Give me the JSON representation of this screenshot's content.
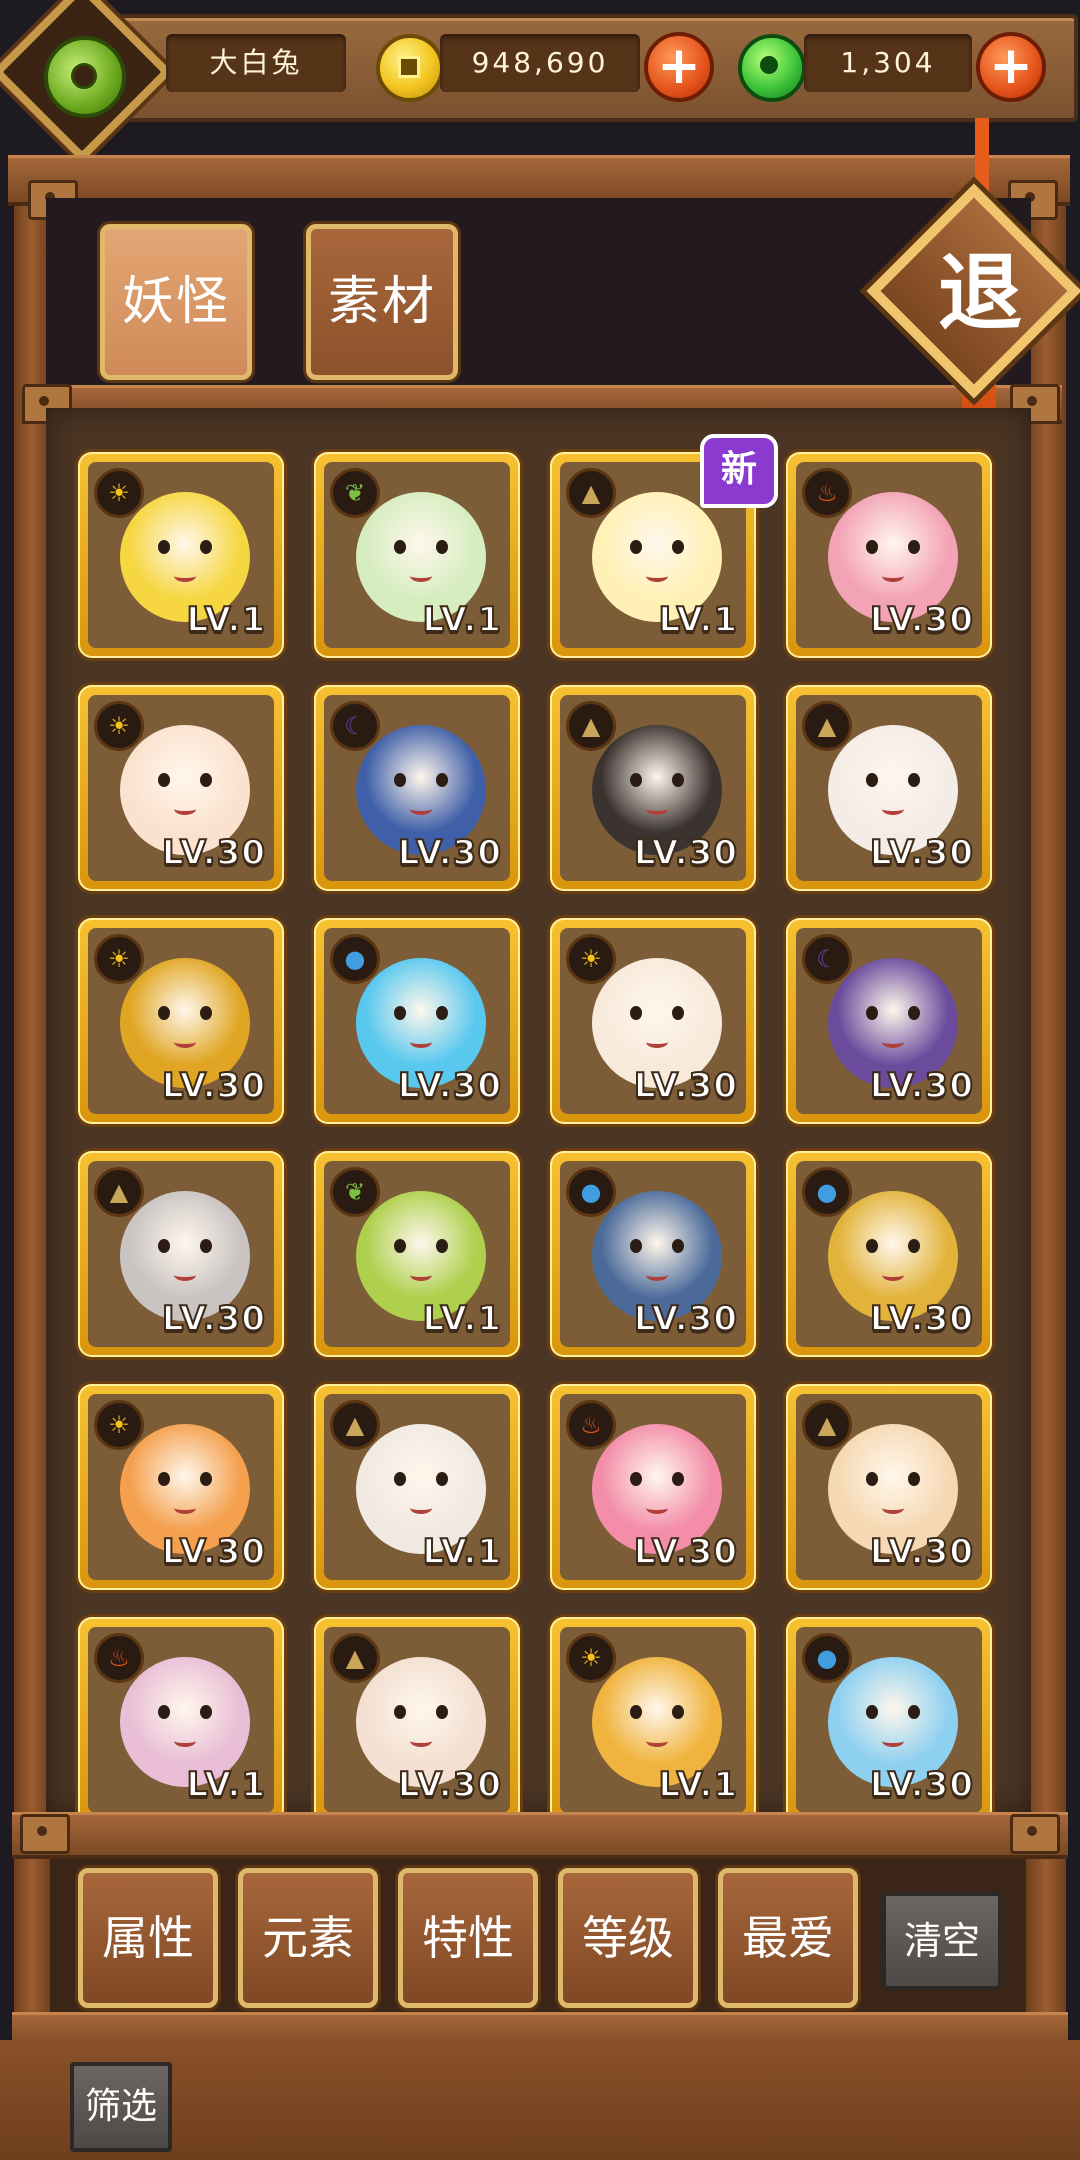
{
  "player": {
    "name": "大白兔"
  },
  "currency": {
    "coins": "948,690",
    "gems": "1,304",
    "coin_icon": "gold-coin-icon",
    "gem_icon": "jade-gem-icon",
    "add_symbol": "+"
  },
  "tabs": [
    {
      "label": "妖怪",
      "active": true
    },
    {
      "label": "素材",
      "active": false
    }
  ],
  "exit_label": "退",
  "monsters": [
    {
      "element": "light",
      "level": "LV.1",
      "color": "#f6d742",
      "new": false
    },
    {
      "element": "leaf",
      "level": "LV.1",
      "color": "#d6edc0",
      "new": false
    },
    {
      "element": "earth",
      "level": "LV.1",
      "color": "#fff1b5",
      "new": true,
      "badge": "新"
    },
    {
      "element": "fire",
      "level": "LV.30",
      "color": "#f3a3b6",
      "new": false
    },
    {
      "element": "light",
      "level": "LV.30",
      "color": "#fbe2cf",
      "new": false
    },
    {
      "element": "dark",
      "level": "LV.30",
      "color": "#3f5fa8",
      "new": false
    },
    {
      "element": "earth",
      "level": "LV.30",
      "color": "#3a3330",
      "new": false
    },
    {
      "element": "earth",
      "level": "LV.30",
      "color": "#f4ece6",
      "new": false
    },
    {
      "element": "light",
      "level": "LV.30",
      "color": "#e0a623",
      "new": false
    },
    {
      "element": "water",
      "level": "LV.30",
      "color": "#58c8ef",
      "new": false
    },
    {
      "element": "light",
      "level": "LV.30",
      "color": "#f7eadb",
      "new": false
    },
    {
      "element": "dark",
      "level": "LV.30",
      "color": "#6a4b9c",
      "new": false
    },
    {
      "element": "earth",
      "level": "LV.30",
      "color": "#c9c3c2",
      "new": false
    },
    {
      "element": "leaf",
      "level": "LV.1",
      "color": "#aed04d",
      "new": false
    },
    {
      "element": "water",
      "level": "LV.30",
      "color": "#4b6a9a",
      "new": false
    },
    {
      "element": "water",
      "level": "LV.30",
      "color": "#e2b33b",
      "new": false
    },
    {
      "element": "light",
      "level": "LV.30",
      "color": "#f4a04e",
      "new": false
    },
    {
      "element": "earth",
      "level": "LV.1",
      "color": "#f1eae2",
      "new": false
    },
    {
      "element": "fire",
      "level": "LV.30",
      "color": "#f38da9",
      "new": false
    },
    {
      "element": "earth",
      "level": "LV.30",
      "color": "#f6d9b4",
      "new": false
    },
    {
      "element": "fire",
      "level": "LV.1",
      "color": "#e9bed6",
      "new": false
    },
    {
      "element": "earth",
      "level": "LV.30",
      "color": "#f3e0d2",
      "new": false
    },
    {
      "element": "light",
      "level": "LV.1",
      "color": "#f0b33d",
      "new": false
    },
    {
      "element": "water",
      "level": "LV.30",
      "color": "#8ed0f0",
      "new": false
    }
  ],
  "element_styles": {
    "light": {
      "icon": "sun-icon",
      "glyph": "☀",
      "color": "#f8c21a"
    },
    "leaf": {
      "icon": "leaf-icon",
      "glyph": "❦",
      "color": "#7cc043"
    },
    "earth": {
      "icon": "mountain-icon",
      "glyph": "▲",
      "color": "#c9a65a"
    },
    "fire": {
      "icon": "flame-icon",
      "glyph": "♨",
      "color": "#e8571a"
    },
    "dark": {
      "icon": "moon-icon",
      "glyph": "☾",
      "color": "#6b3fa8"
    },
    "water": {
      "icon": "droplet-icon",
      "glyph": "●",
      "color": "#3f9de0"
    }
  },
  "filters": [
    "属性",
    "元素",
    "特性",
    "等级",
    "最爱"
  ],
  "clear_label": "清空",
  "filter_label": "筛选"
}
